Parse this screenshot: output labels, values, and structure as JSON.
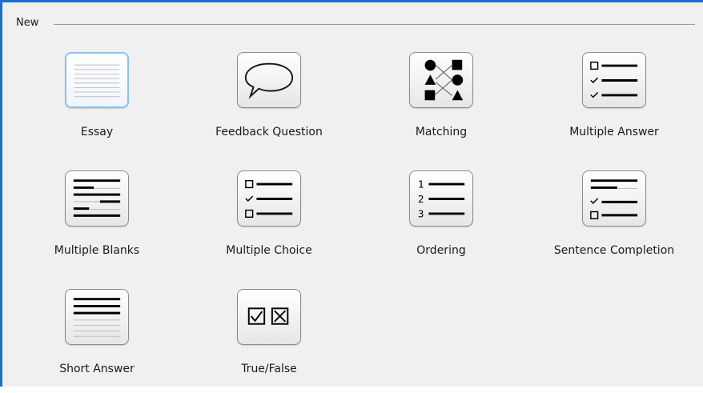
{
  "group": {
    "title": "New"
  },
  "items": [
    {
      "label": "Essay",
      "icon": "essay-icon"
    },
    {
      "label": "Feedback Question",
      "icon": "speech-bubble-icon"
    },
    {
      "label": "Matching",
      "icon": "matching-shapes-icon"
    },
    {
      "label": "Multiple Answer",
      "icon": "checklist-icon"
    },
    {
      "label": "Multiple Blanks",
      "icon": "blanks-lines-icon"
    },
    {
      "label": "Multiple Choice",
      "icon": "choice-list-icon"
    },
    {
      "label": "Ordering",
      "icon": "numbered-list-icon"
    },
    {
      "label": "Sentence Completion",
      "icon": "sentence-completion-icon"
    },
    {
      "label": "Short Answer",
      "icon": "short-answer-icon"
    },
    {
      "label": "True/False",
      "icon": "checkbox-pair-icon"
    }
  ],
  "colors": {
    "accent": "#1a6fd0",
    "selected_border": "#8fc0ef"
  }
}
